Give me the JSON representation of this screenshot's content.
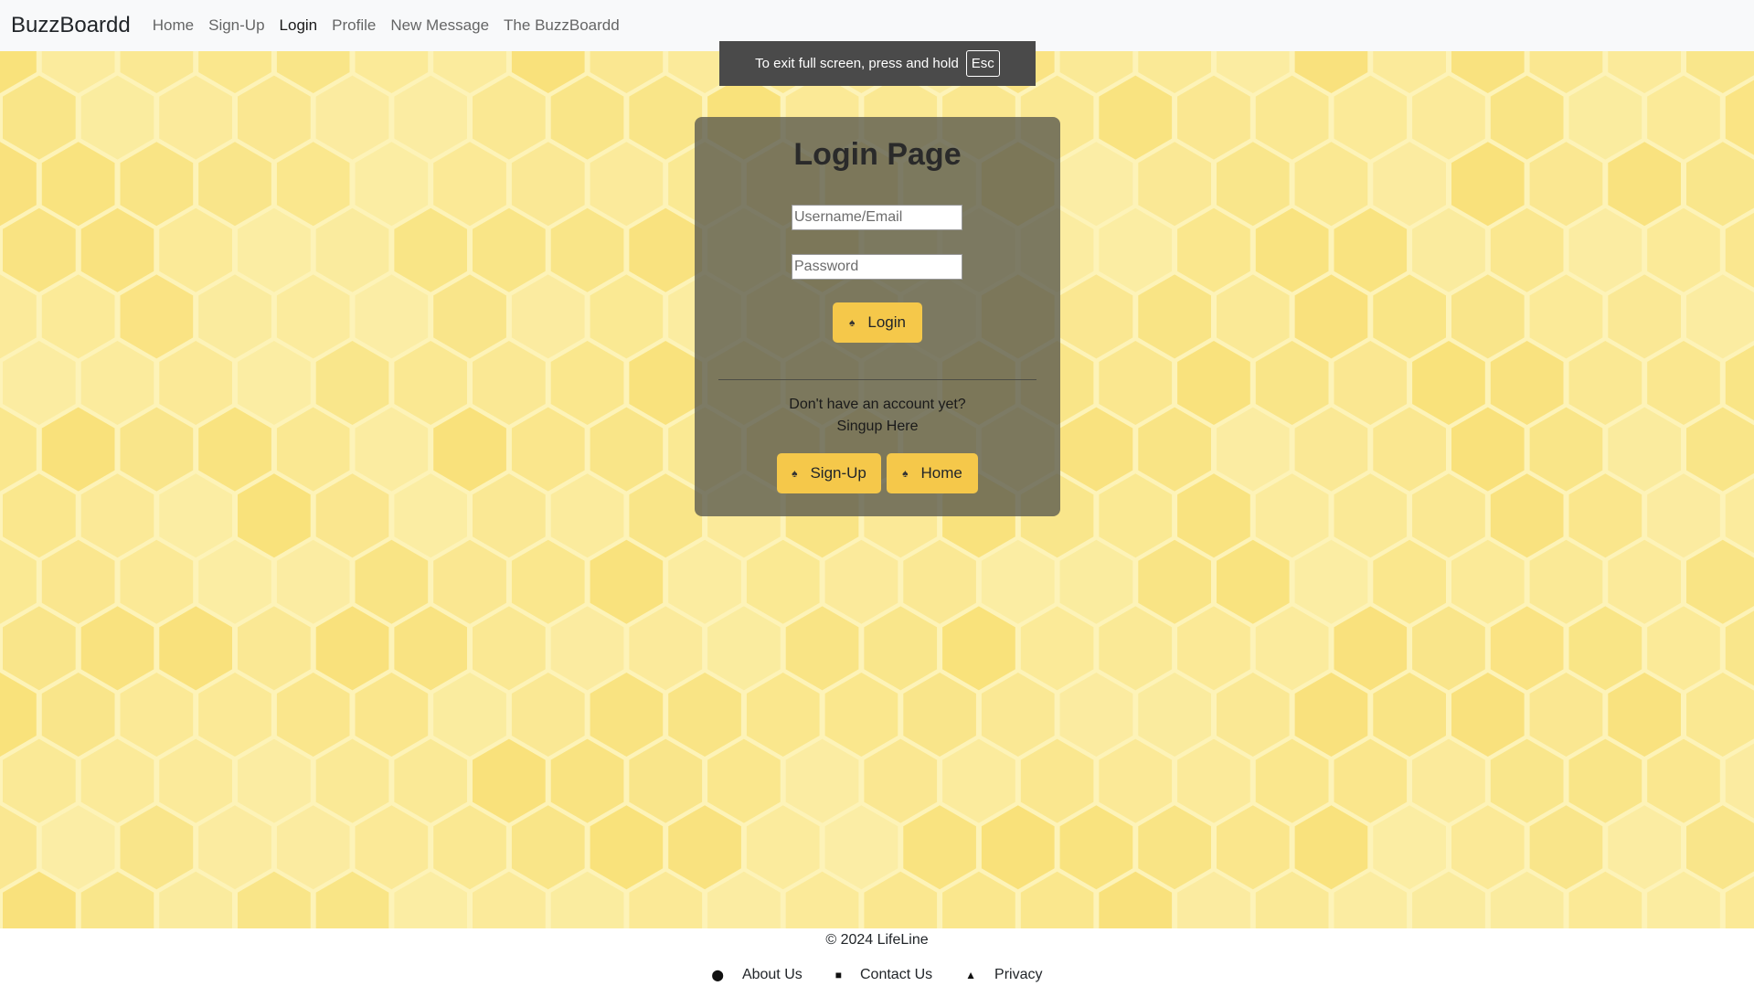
{
  "navbar": {
    "brand": "BuzzBoardd",
    "links": [
      {
        "label": "Home"
      },
      {
        "label": "Sign-Up"
      },
      {
        "label": "Login"
      },
      {
        "label": "Profile"
      },
      {
        "label": "New Message"
      },
      {
        "label": "The BuzzBoardd"
      }
    ],
    "active": "Login"
  },
  "fullscreen_toast": {
    "text": "To exit full screen, press and hold",
    "key": "Esc"
  },
  "login_card": {
    "title": "Login Page",
    "username_placeholder": "Username/Email",
    "password_placeholder": "Password",
    "login_button": "Login",
    "signup_prompt_line1": "Don't have an account yet?",
    "signup_prompt_line2": "Singup Here",
    "signup_button": "Sign-Up",
    "home_button": "Home",
    "button_icon": "bee-icon"
  },
  "footer": {
    "copyright": "© 2024 LifeLine",
    "links": [
      {
        "label": "About Us",
        "icon": "info-circle-icon"
      },
      {
        "label": "Contact Us",
        "icon": "contact-card-icon"
      },
      {
        "label": "Privacy",
        "icon": "lock-icon"
      }
    ]
  },
  "colors": {
    "accent": "#f5c84a",
    "honeycomb_light": "#fdf3b8",
    "honeycomb_cell": "#f7dc6a",
    "card_overlay": "#58584e",
    "navbar_bg": "#f8f9fa"
  }
}
